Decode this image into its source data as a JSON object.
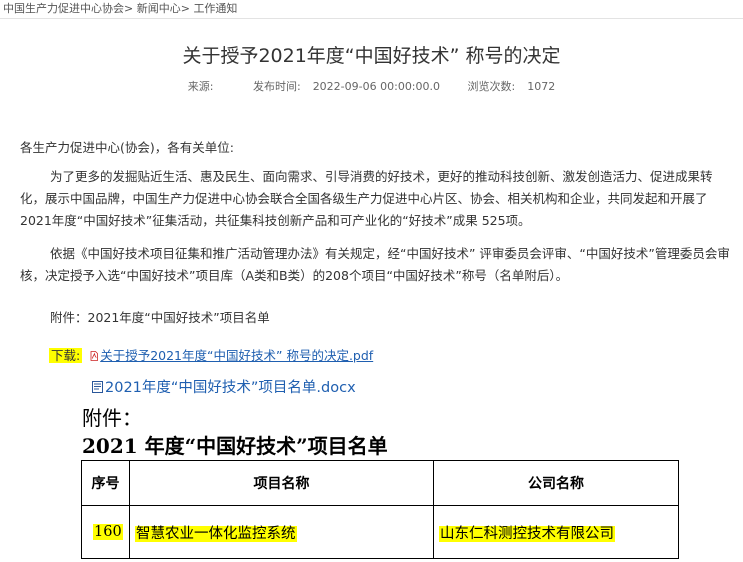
{
  "breadcrumb": {
    "items": [
      "中国生产力促进中心协会",
      "新闻中心",
      "工作通知"
    ],
    "separator": ">"
  },
  "article": {
    "title": "关于授予2021年度“中国好技术” 称号的决定",
    "source_label": "来源:",
    "source_value": "",
    "publish_label": "发布时间:",
    "publish_value": "2022-09-06 00:00:00.0",
    "views_label": "浏览次数:",
    "views_value": "1072",
    "greeting": "各生产力促进中心(协会)，各有关单位:",
    "paragraph1": "为了更多的发掘贴近生活、惠及民生、面向需求、引导消费的好技术，更好的推动科技创新、激发创造活力、促进成果转化，展示中国品牌，中国生产力促进中心协会联合全国各级生产力促进中心片区、协会、相关机构和企业，共同发起和开展了2021年度“中国好技术”征集活动，共征集科技创新产品和可产业化的“好技术”成果 525项。",
    "paragraph2": "依据《中国好技术项目征集和推广活动管理办法》有关规定，经“中国好技术” 评审委员会评审、“中国好技术”管理委员会审核，决定授予入选“中国好技术”项目库（A类和B类）的208个项目“中国好技术”称号（名单附后）。",
    "attachment_line": "附件：2021年度“中国好技术”项目名单"
  },
  "downloads": {
    "label": "下载:",
    "pdf_link": "关于授予2021年度“中国好技术” 称号的决定.pdf",
    "docx_link": "2021年度“中国好技术”项目名单.docx",
    "pdf_icon": "pdf-file-icon",
    "docx_icon": "word-file-icon"
  },
  "document_preview": {
    "attach_heading": "附件：",
    "list_title": "2021 年度“中国好技术”项目名单",
    "columns": [
      "序号",
      "项目名称",
      "公司名称"
    ],
    "rows": [
      {
        "num": "160",
        "name": "智慧农业一体化监控系统",
        "company": "山东仁科测控技术有限公司"
      }
    ]
  },
  "colors": {
    "highlight": "#ffff00",
    "link": "#1f5fb0",
    "text": "#333333"
  }
}
